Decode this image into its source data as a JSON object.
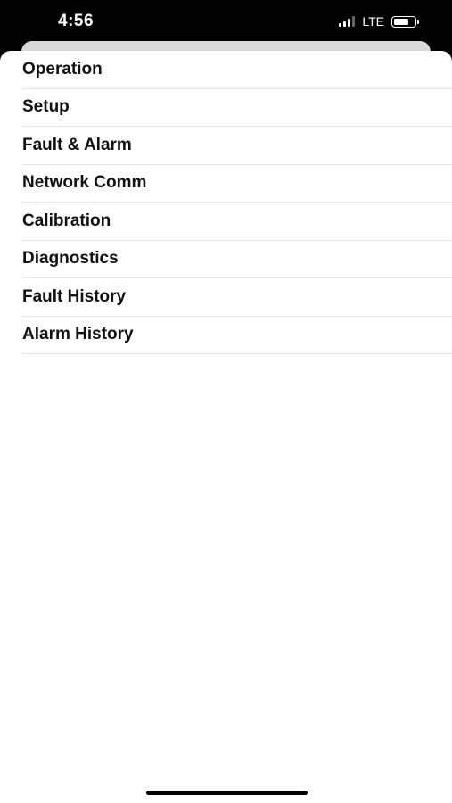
{
  "status_bar": {
    "time": "4:56",
    "network": "LTE",
    "signal_bars": 4,
    "signal_active_bars": 3,
    "battery_level": 0.85
  },
  "menu": {
    "items": [
      {
        "label": "Operation"
      },
      {
        "label": "Setup"
      },
      {
        "label": "Fault & Alarm"
      },
      {
        "label": "Network Comm"
      },
      {
        "label": "Calibration"
      },
      {
        "label": "Diagnostics"
      },
      {
        "label": "Fault History"
      },
      {
        "label": "Alarm History"
      }
    ]
  },
  "colors": {
    "background": "#000000",
    "sheet": "#ffffff",
    "text": "#111111",
    "separator": "#e6e6e6"
  }
}
